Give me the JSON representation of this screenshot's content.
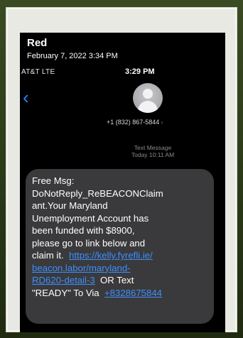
{
  "photo": {
    "sender": "Red",
    "date": "February 7, 2022 3:34 PM"
  },
  "status_bar": {
    "carrier": "AT&T  LTE",
    "time": "3:29 PM"
  },
  "contact": {
    "number": "+1 (832) 867-5844",
    "chevron": "›"
  },
  "message_meta": {
    "type": "Text Message",
    "time": "Today 10:11 AM"
  },
  "message": {
    "line1": "Free Msg:",
    "line2": "DoNotReply_ReBEACONClaim",
    "line3": "ant.Your Maryland",
    "line4": "Unemployment Account has",
    "line5": "been funded with $8900,",
    "line6": "please go to link below and",
    "line7_text": "claim it.",
    "line7_link": "https://kelly.fyrefli.ie/",
    "line8_link": "beacon.labor/maryland-",
    "line9_link": "RD620-detail-3",
    "line9_text": "OR Text",
    "line10_text": "\"READY\" To Via",
    "line10_link": "+8328675844"
  },
  "colors": {
    "link": "#3d8eff",
    "bubble": "#3a3a3c",
    "back_chevron": "#1f8bff"
  },
  "icons": {
    "back": "chevron-left-icon",
    "avatar": "person-silhouette-icon"
  }
}
